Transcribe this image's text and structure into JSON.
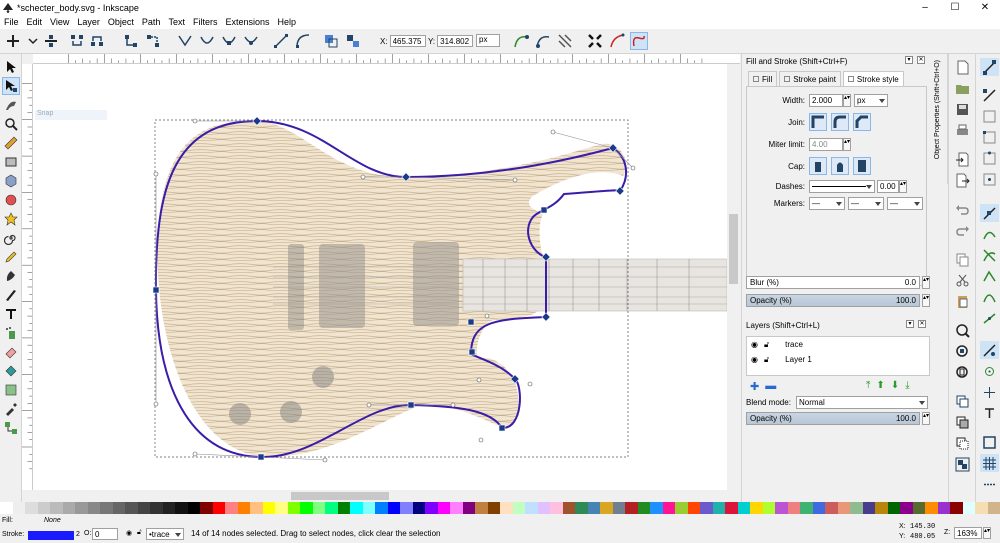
{
  "window": {
    "title": "*schecter_body.svg - Inkscape",
    "controls": {
      "minimize": "–",
      "maximize": "☐",
      "close": "✕"
    }
  },
  "menu": [
    "File",
    "Edit",
    "View",
    "Layer",
    "Object",
    "Path",
    "Text",
    "Filters",
    "Extensions",
    "Help"
  ],
  "toolbar": {
    "x_label": "X:",
    "x_value": "465.375",
    "y_label": "Y:",
    "y_value": "314.802",
    "unit": "px"
  },
  "canvas": {
    "snap_tooltip": "Snap"
  },
  "fill_stroke": {
    "title": "Fill and Stroke (Shift+Ctrl+F)",
    "tabs": [
      "Fill",
      "Stroke paint",
      "Stroke style"
    ],
    "active_tab": "Stroke style",
    "width_label": "Width:",
    "width_value": "2.000",
    "width_unit": "px",
    "join_label": "Join:",
    "miter_label": "Miter limit:",
    "miter_value": "4.00",
    "cap_label": "Cap:",
    "dashes_label": "Dashes:",
    "dashes_offset": "0.00",
    "markers_label": "Markers:",
    "blur_label": "Blur (%)",
    "blur_value": "0.0",
    "opacity_label": "Opacity (%)",
    "opacity_value": "100.0"
  },
  "layers_panel": {
    "title": "Layers (Shift+Ctrl+L)",
    "layers": [
      "trace",
      "Layer 1"
    ],
    "blend_label": "Blend mode:",
    "blend_value": "Normal",
    "opacity_label": "Opacity (%)",
    "opacity_value": "100.0"
  },
  "side_tab": "Object Properties (Shift+Ctrl+O)",
  "status": {
    "fill_label": "Fill:",
    "fill_value": "None",
    "stroke_label": "Stroke:",
    "stroke_width": "2",
    "opacity_label": "O:",
    "opacity_value": "0",
    "layer": "•trace",
    "message": "14 of 14 nodes selected. Drag to select nodes, click clear the selection",
    "x_label": "X:",
    "x": "145.30",
    "y_label": "Y:",
    "y": "480.05",
    "zoom_label": "Z:",
    "zoom": "163%"
  },
  "colors": {
    "path_stroke": "#3a1ca8",
    "wood": "#e8d6b8",
    "selection_blue": "#cfe3f7"
  }
}
